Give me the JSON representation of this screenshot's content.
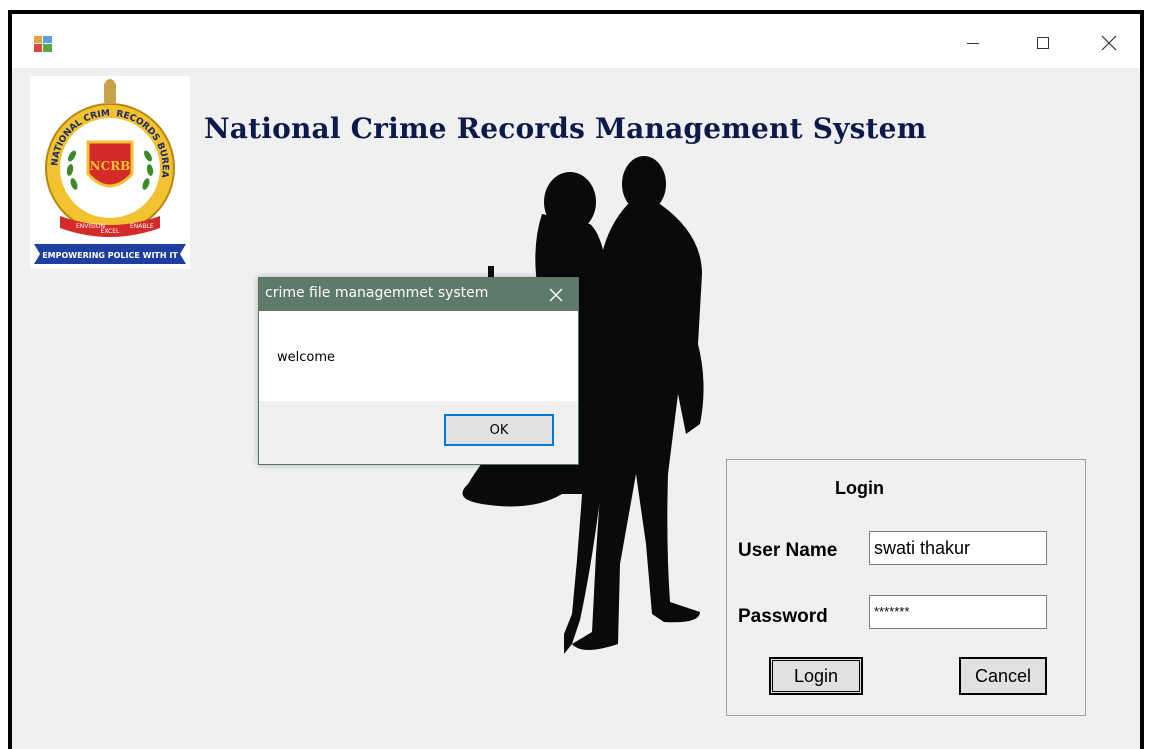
{
  "window": {
    "title": "",
    "controls": {
      "minimize_icon": "minimize-icon",
      "maximize_icon": "maximize-icon",
      "close_icon": "close-icon"
    }
  },
  "header": {
    "title": "National Crime Records Management System",
    "title_color": "#0b1a4a"
  },
  "logo": {
    "top_text_left": "NATIONAL CRIME",
    "top_text_right": "RECORDS BUREAU",
    "center_text": "NCRB",
    "motto_left": "ENVISION",
    "motto_center": "EXCEL",
    "motto_right": "ENABLE",
    "banner_text": "EMPOWERING POLICE WITH IT"
  },
  "login": {
    "title": "Login",
    "username_label": "User Name",
    "username_value": "swati thakur",
    "password_label": "Password",
    "password_value": "*******",
    "login_button": "Login",
    "cancel_button": "Cancel"
  },
  "dialog": {
    "title": "crime file managemmet system",
    "message": "welcome",
    "ok_button": "OK",
    "titlebar_color": "#5d7a6a"
  }
}
